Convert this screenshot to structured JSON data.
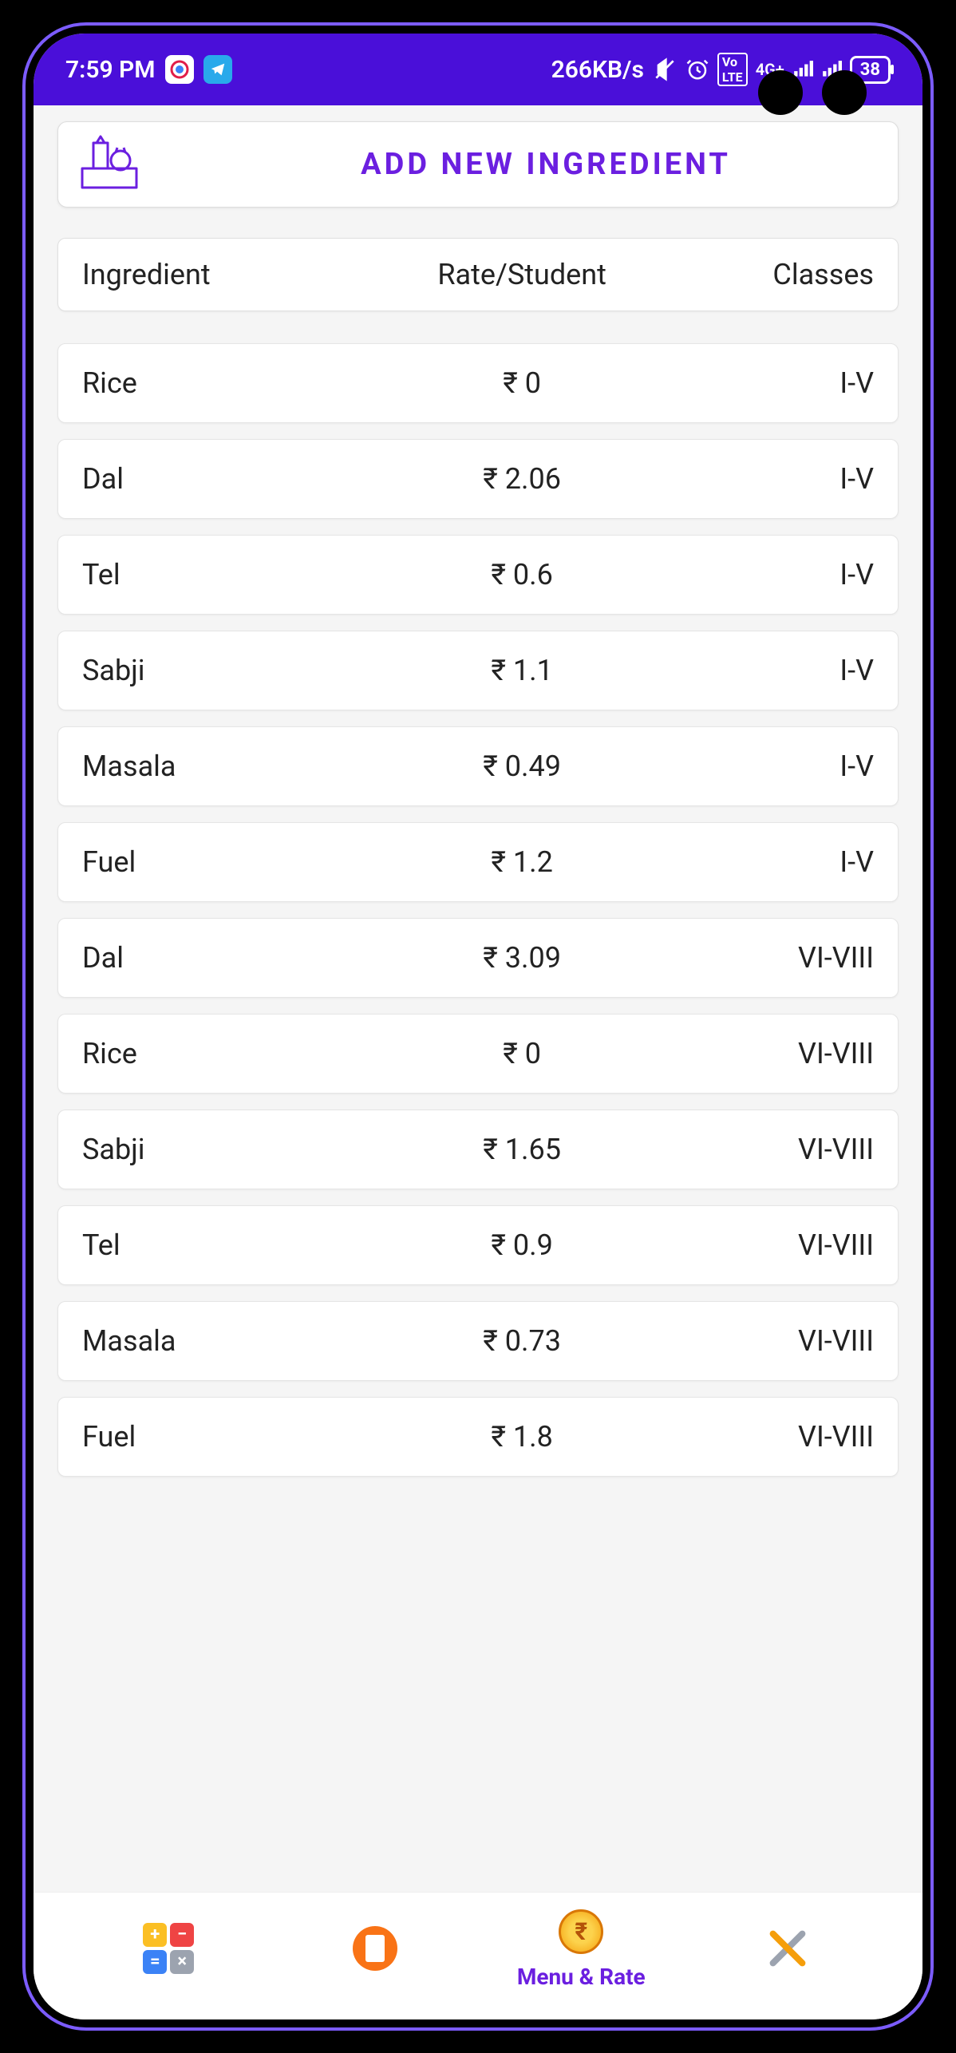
{
  "status": {
    "time": "7:59 PM",
    "datarate": "266KB/s",
    "battery": "38",
    "network": "4G+"
  },
  "header": {
    "add_label": "ADD NEW INGREDIENT"
  },
  "table": {
    "col_ingredient": "Ingredient",
    "col_rate": "Rate/Student",
    "col_classes": "Classes"
  },
  "rows": [
    {
      "name": "Rice",
      "rate": "₹ 0",
      "classes": "I-V"
    },
    {
      "name": "Dal",
      "rate": "₹ 2.06",
      "classes": "I-V"
    },
    {
      "name": "Tel",
      "rate": "₹ 0.6",
      "classes": "I-V"
    },
    {
      "name": "Sabji",
      "rate": "₹ 1.1",
      "classes": "I-V"
    },
    {
      "name": "Masala",
      "rate": "₹ 0.49",
      "classes": "I-V"
    },
    {
      "name": "Fuel",
      "rate": "₹ 1.2",
      "classes": "I-V"
    },
    {
      "name": "Dal",
      "rate": "₹ 3.09",
      "classes": "VI-VIII"
    },
    {
      "name": "Rice",
      "rate": "₹ 0",
      "classes": "VI-VIII"
    },
    {
      "name": "Sabji",
      "rate": "₹ 1.65",
      "classes": "VI-VIII"
    },
    {
      "name": "Tel",
      "rate": "₹ 0.9",
      "classes": "VI-VIII"
    },
    {
      "name": "Masala",
      "rate": "₹ 0.73",
      "classes": "VI-VIII"
    },
    {
      "name": "Fuel",
      "rate": "₹ 1.8",
      "classes": "VI-VIII"
    }
  ],
  "nav": {
    "active_label": "Menu & Rate"
  }
}
